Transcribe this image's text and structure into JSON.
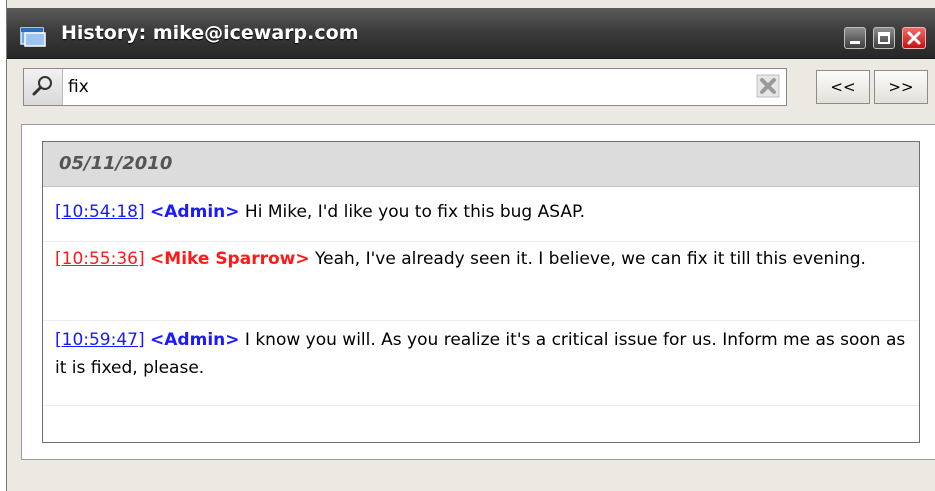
{
  "window": {
    "title": "History: mike@icewarp.com"
  },
  "search": {
    "value": "fix",
    "prev_label": "<<",
    "next_label": ">>"
  },
  "history": {
    "date": "05/11/2010",
    "messages": [
      {
        "time": "[10:54:18]",
        "sender": "<Admin>",
        "text": "Hi Mike, I'd like you to fix this bug ASAP.",
        "color": "#1a1aff"
      },
      {
        "time": "[10:55:36]",
        "sender": "<Mike Sparrow>",
        "text": "Yeah, I've already seen it. I believe, we can fix it till this evening.",
        "color": "#ff1a1a"
      },
      {
        "time": "[10:59:47]",
        "sender": "<Admin>",
        "text": "I know you will. As you realize it's a critical issue for us. Inform me as soon as it is fixed, please.",
        "color": "#1a1aff"
      }
    ]
  },
  "icons": {
    "app": "window-icon",
    "search": "magnifier-icon",
    "clear": "clear-x-icon",
    "minimize": "minimize-icon",
    "maximize": "maximize-icon",
    "close": "close-icon"
  }
}
